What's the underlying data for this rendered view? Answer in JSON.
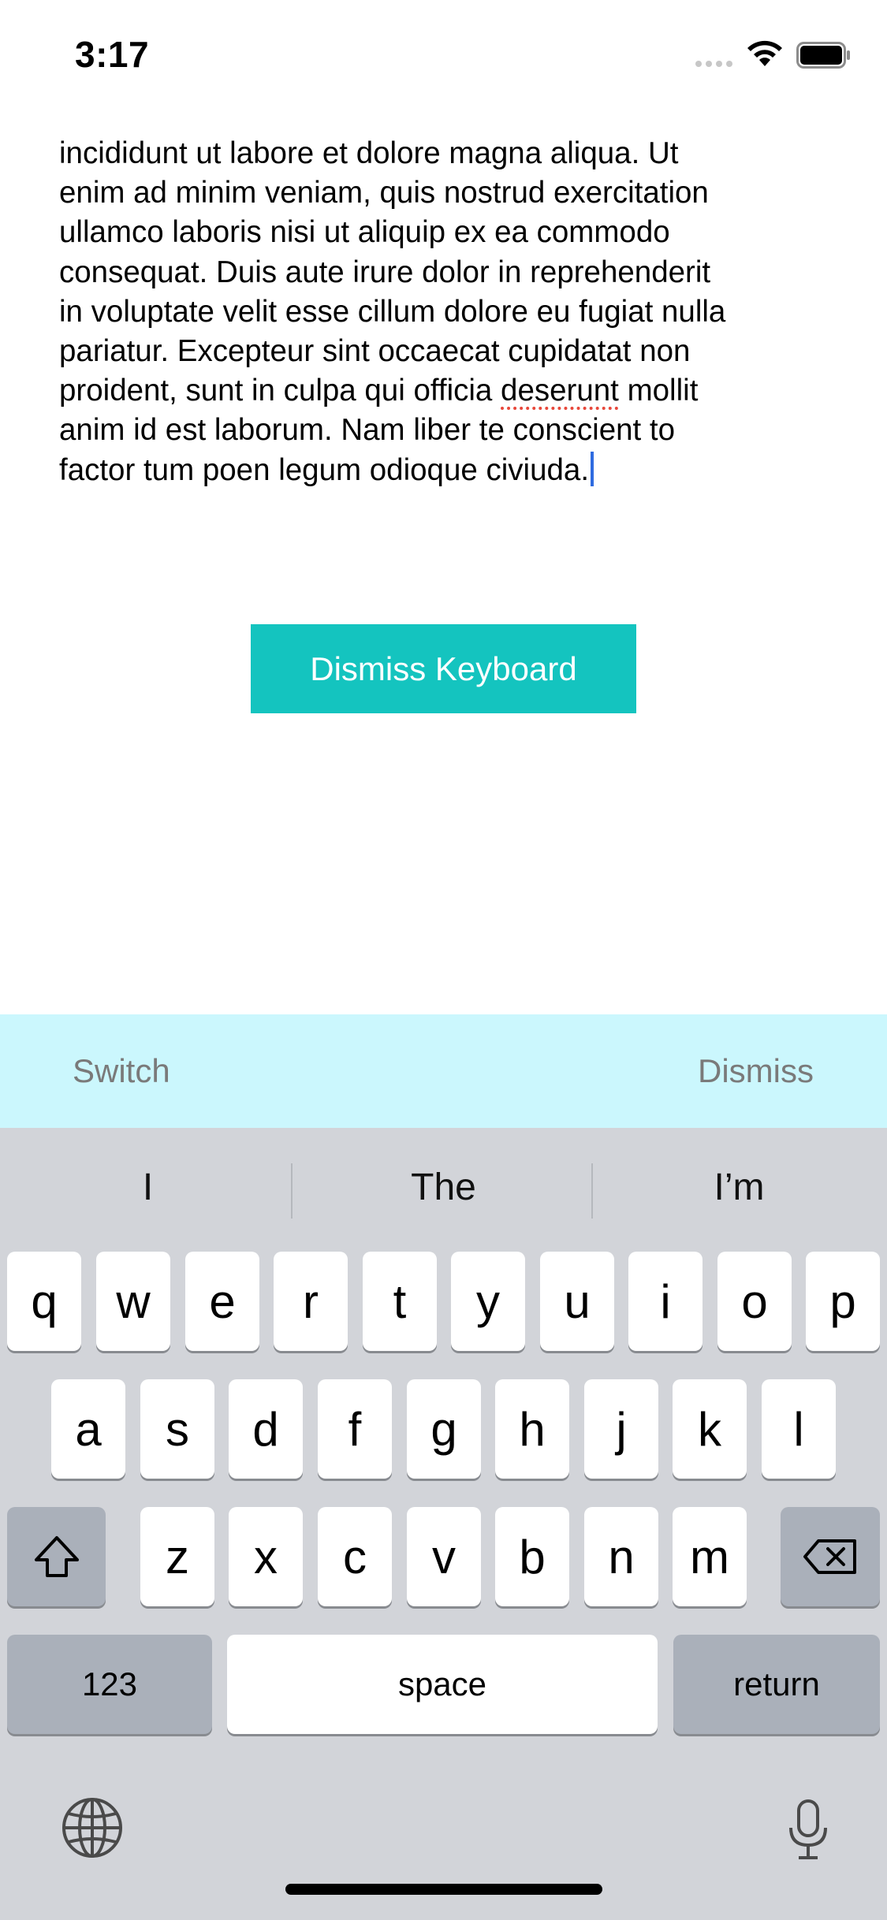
{
  "status_bar": {
    "time": "3:17"
  },
  "text_view": {
    "lines": [
      "incididunt ut labore et dolore magna aliqua. Ut",
      "enim ad minim veniam, quis nostrud exercitation",
      "ullamco laboris nisi ut aliquip ex ea commodo",
      "consequat. Duis aute irure dolor in reprehenderit",
      "in voluptate velit esse cillum dolore eu fugiat nulla",
      "pariatur. Excepteur sint occaecat cupidatat non",
      "proident, sunt in culpa qui officia ",
      "deserunt",
      " mollit",
      "anim id est laborum. Nam liber te conscient to",
      "factor tum poen legum odioque civiuda."
    ]
  },
  "dismiss_button": {
    "label": "Dismiss Keyboard"
  },
  "accessory_bar": {
    "switch_label": "Switch",
    "dismiss_label": "Dismiss"
  },
  "keyboard": {
    "suggestions": [
      "I",
      "The",
      "I’m"
    ],
    "row1": [
      "q",
      "w",
      "e",
      "r",
      "t",
      "y",
      "u",
      "i",
      "o",
      "p"
    ],
    "row2": [
      "a",
      "s",
      "d",
      "f",
      "g",
      "h",
      "j",
      "k",
      "l"
    ],
    "row3": [
      "z",
      "x",
      "c",
      "v",
      "b",
      "n",
      "m"
    ],
    "numbers_label": "123",
    "space_label": "space",
    "return_label": "return",
    "icons": {
      "shift": "shift-icon",
      "delete": "delete-icon",
      "globe": "globe-icon",
      "mic": "microphone-icon"
    }
  },
  "colors": {
    "button": "#14c4bf",
    "accessory_bg": "#cbf7fd",
    "keyboard_bg": "#d2d4d9",
    "caret": "#2f6be0"
  }
}
